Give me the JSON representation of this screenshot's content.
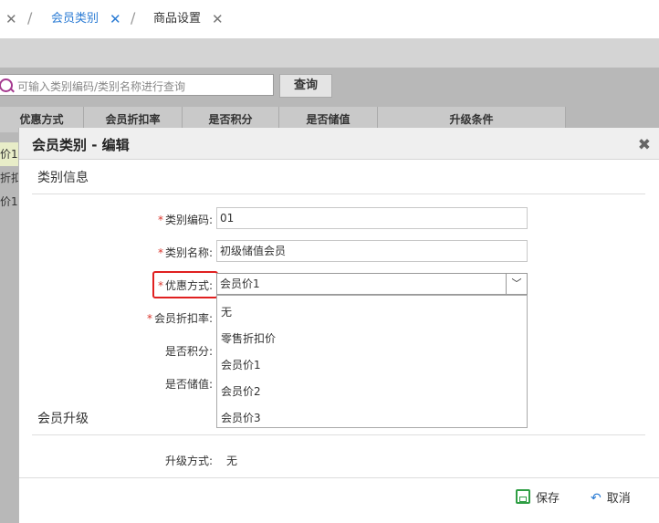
{
  "tabs": [
    {
      "label": "会员类别",
      "active": true
    },
    {
      "label": "商品设置",
      "active": false
    }
  ],
  "search": {
    "placeholder": "可输入类别编码/类别名称进行查询",
    "button_label": "查询"
  },
  "grid": {
    "headers": [
      "优惠方式",
      "会员折扣率",
      "是否积分",
      "是否储值",
      "升级条件"
    ],
    "rows": [
      "价1",
      "折扣",
      "价1"
    ]
  },
  "dialog": {
    "title": "会员类别 - 编辑",
    "section_info": "类别信息",
    "section_upgrade": "会员升级",
    "fields": {
      "code_label": "类别编码:",
      "code_value": "01",
      "name_label": "类别名称:",
      "name_value": "初级储值会员",
      "discount_mode_label": "优惠方式:",
      "discount_mode_value": "会员价1",
      "discount_rate_label": "会员折扣率:",
      "points_label": "是否积分:",
      "stored_value_label": "是否储值:",
      "upgrade_mode_label": "升级方式:",
      "upgrade_mode_value": "无"
    },
    "dropdown_options": [
      "无",
      "零售折扣价",
      "会员价1",
      "会员价2",
      "会员价3"
    ],
    "save_label": "保存",
    "cancel_label": "取消",
    "required_mark": "*"
  },
  "colors": {
    "accent": "#2a7bd4",
    "required": "#d9342b",
    "highlight": "#e02020",
    "save": "#2f9e44"
  }
}
